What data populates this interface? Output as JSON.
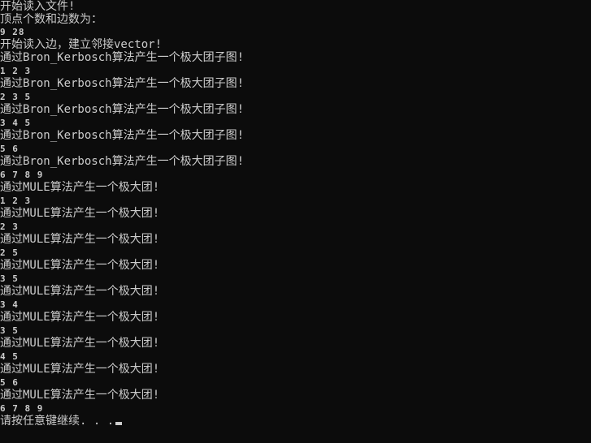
{
  "console": {
    "lines": [
      "开始读入文件!",
      "顶点个数和边数为：",
      "9 28",
      "开始读入边，建立邻接vector!",
      "通过Bron_Kerbosch算法产生一个极大团子图!",
      "1 2 3",
      "通过Bron_Kerbosch算法产生一个极大团子图!",
      "2 3 5",
      "通过Bron_Kerbosch算法产生一个极大团子图!",
      "3 4 5",
      "通过Bron_Kerbosch算法产生一个极大团子图!",
      "5 6",
      "通过Bron_Kerbosch算法产生一个极大团子图!",
      "6 7 8 9",
      "通过MULE算法产生一个极大团!",
      "1 2 3",
      "通过MULE算法产生一个极大团!",
      "2 3",
      "通过MULE算法产生一个极大团!",
      "2 5",
      "通过MULE算法产生一个极大团!",
      "3 5",
      "通过MULE算法产生一个极大团!",
      "3 4",
      "通过MULE算法产生一个极大团!",
      "3 5",
      "通过MULE算法产生一个极大团!",
      "4 5",
      "通过MULE算法产生一个极大团!",
      "5 6",
      "通过MULE算法产生一个极大团!",
      "6 7 8 9",
      "请按任意键继续. . ."
    ]
  }
}
